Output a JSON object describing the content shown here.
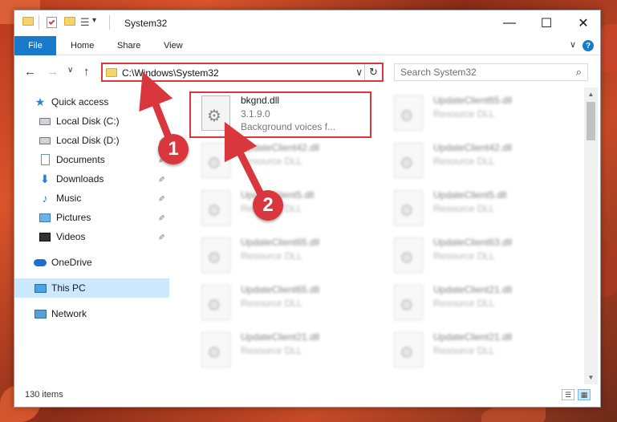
{
  "window": {
    "title": "System32",
    "minimize": "—",
    "maximize": "☐",
    "close": "✕"
  },
  "ribbon": {
    "tabs": [
      "File",
      "Home",
      "Share",
      "View"
    ],
    "collapse_glyph": "∨",
    "help_glyph": "?"
  },
  "nav": {
    "back": "←",
    "forward": "→",
    "recent": "∨",
    "up": "↑",
    "address": "C:\\Windows\\System32",
    "address_dropdown": "∨",
    "refresh": "↻",
    "search_placeholder": "Search System32",
    "search_glyph": "⌕"
  },
  "sidebar": {
    "items": [
      {
        "label": "Quick access",
        "icon": "star-icon"
      },
      {
        "label": "Local Disk (C:)",
        "icon": "drive-icon",
        "pinned": true
      },
      {
        "label": "Local Disk (D:)",
        "icon": "drive-icon",
        "pinned": true
      },
      {
        "label": "Documents",
        "icon": "documents-icon",
        "pinned": true
      },
      {
        "label": "Downloads",
        "icon": "download-icon",
        "pinned": true
      },
      {
        "label": "Music",
        "icon": "music-icon",
        "pinned": true
      },
      {
        "label": "Pictures",
        "icon": "pictures-icon",
        "pinned": true
      },
      {
        "label": "Videos",
        "icon": "videos-icon",
        "pinned": true
      },
      {
        "label": "OneDrive",
        "icon": "cloud-icon"
      },
      {
        "label": "This PC",
        "icon": "computer-icon",
        "selected": true
      },
      {
        "label": "Network",
        "icon": "network-icon"
      }
    ],
    "pin_glyph": "📌"
  },
  "files": [
    {
      "name": "bkgnd.dll",
      "line2": "3.1.9.0",
      "line3": "Background voices f...",
      "highlighted": true
    },
    {
      "name": "UpdateClient65.dll",
      "line2": "Resource DLL"
    },
    {
      "name": "UpdateClient42.dll",
      "line2": "Resource DLL"
    },
    {
      "name": "UpdateClient42.dll",
      "line2": "Resource DLL"
    },
    {
      "name": "UpdateClient5.dll",
      "line2": "Resource DLL"
    },
    {
      "name": "UpdateClient5.dll",
      "line2": "Resource DLL"
    },
    {
      "name": "UpdateClient65.dll",
      "line2": "Resource DLL"
    },
    {
      "name": "UpdateClient63.dll",
      "line2": "Resource DLL"
    },
    {
      "name": "UpdateClient65.dll",
      "line2": "Resource DLL"
    },
    {
      "name": "UpdateClient21.dll",
      "line2": "Resource DLL"
    },
    {
      "name": "UpdateClient21.dll",
      "line2": "Resource DLL"
    },
    {
      "name": "UpdateClient21.dll",
      "line2": "Resource DLL"
    }
  ],
  "status": {
    "item_count": "130 items"
  },
  "annotations": {
    "step1": "1",
    "step2": "2"
  },
  "colors": {
    "accent": "#1979ca",
    "highlight_red": "#d9363e",
    "selected_bg": "#cce8ff"
  }
}
